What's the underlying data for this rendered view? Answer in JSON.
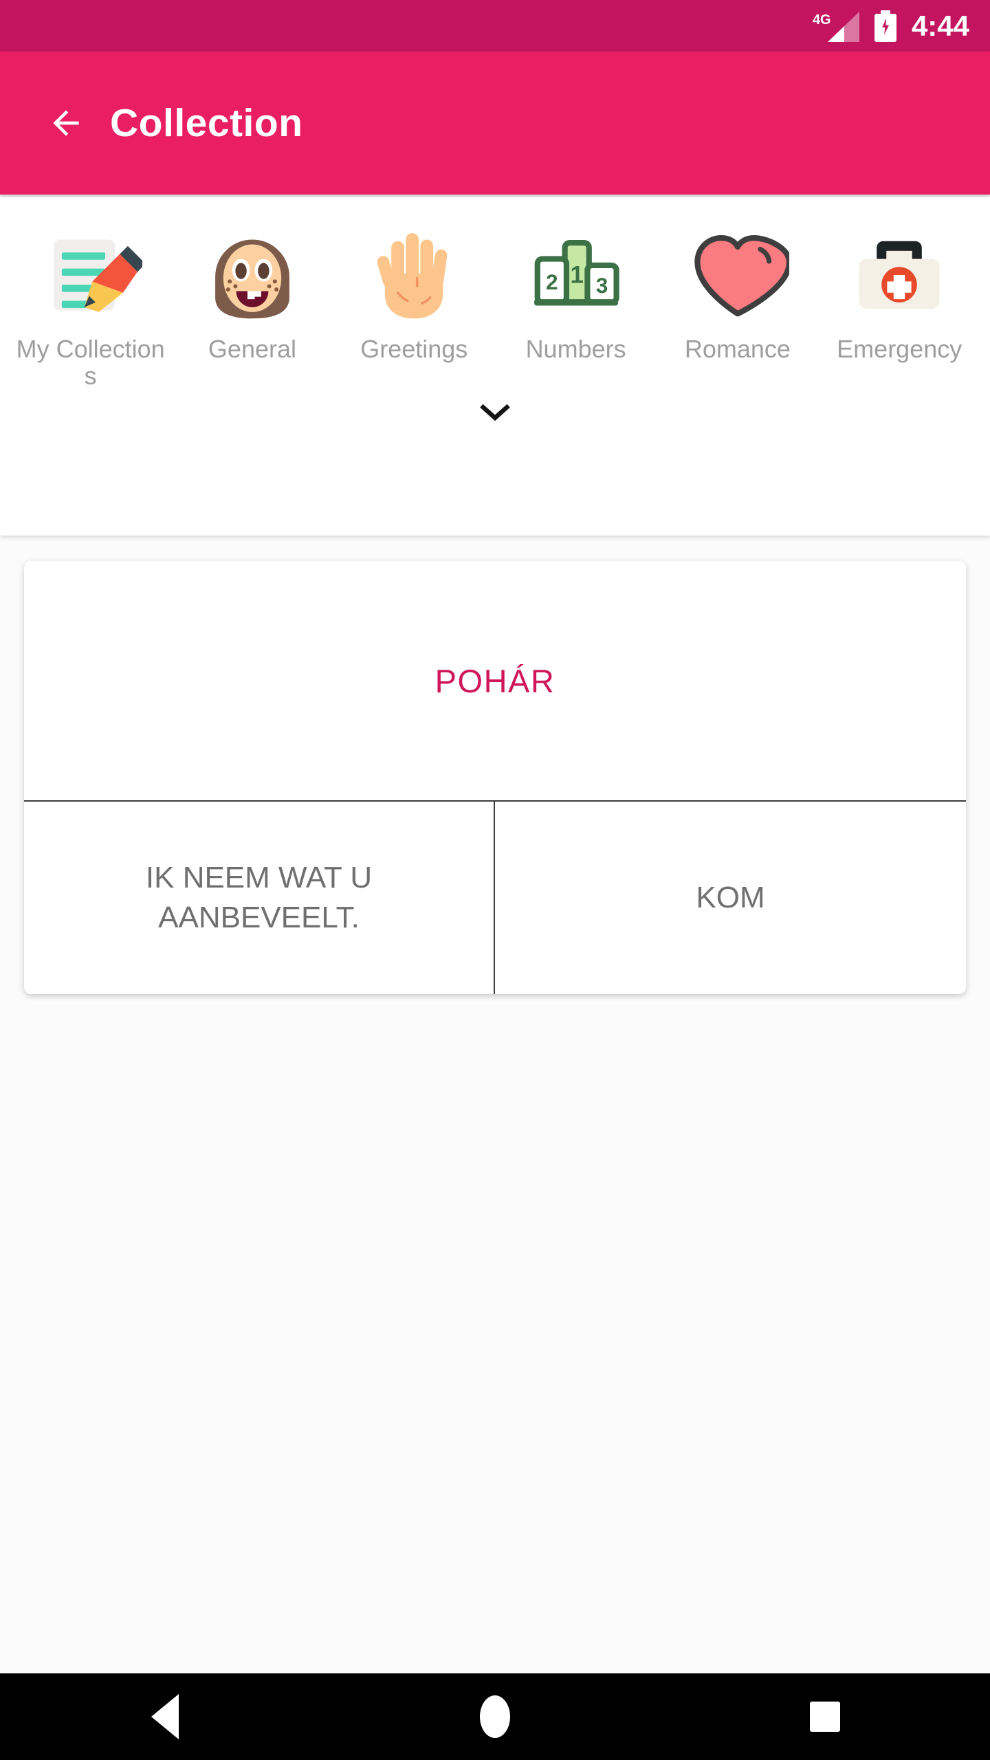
{
  "status_bar": {
    "network_label": "4G",
    "time": "4:44",
    "signal_icon": "signal-bars-icon",
    "battery_icon": "battery-charging-icon",
    "background_color": "#c2145f"
  },
  "app_bar": {
    "title": "Collection",
    "back_icon": "arrow-back-icon",
    "background_color": "#e91e63",
    "title_color": "#ffffff"
  },
  "categories": {
    "expander_icon": "chevron-down-icon",
    "label_color": "#9e9e9e",
    "items": [
      {
        "label": "My Collections",
        "icon": "memo-pencil-icon"
      },
      {
        "label": "General",
        "icon": "girl-face-icon"
      },
      {
        "label": "Greetings",
        "icon": "raised-hand-icon"
      },
      {
        "label": "Numbers",
        "icon": "podium-icon"
      },
      {
        "label": "Romance",
        "icon": "heart-icon"
      },
      {
        "label": "Emergency",
        "icon": "first-aid-kit-icon"
      }
    ]
  },
  "phrase_card": {
    "headword": "POHÁR",
    "headword_color": "#cf1659",
    "cells": [
      {
        "text": "IK NEEM WAT U AANBEVEELT."
      },
      {
        "text": "KOM"
      }
    ],
    "cell_text_color": "#6f6f6f"
  },
  "nav_bar": {
    "background_color": "#000000",
    "buttons": [
      {
        "name": "back",
        "icon": "triangle-back-icon"
      },
      {
        "name": "home",
        "icon": "circle-home-icon"
      },
      {
        "name": "recents",
        "icon": "square-recents-icon"
      }
    ]
  }
}
